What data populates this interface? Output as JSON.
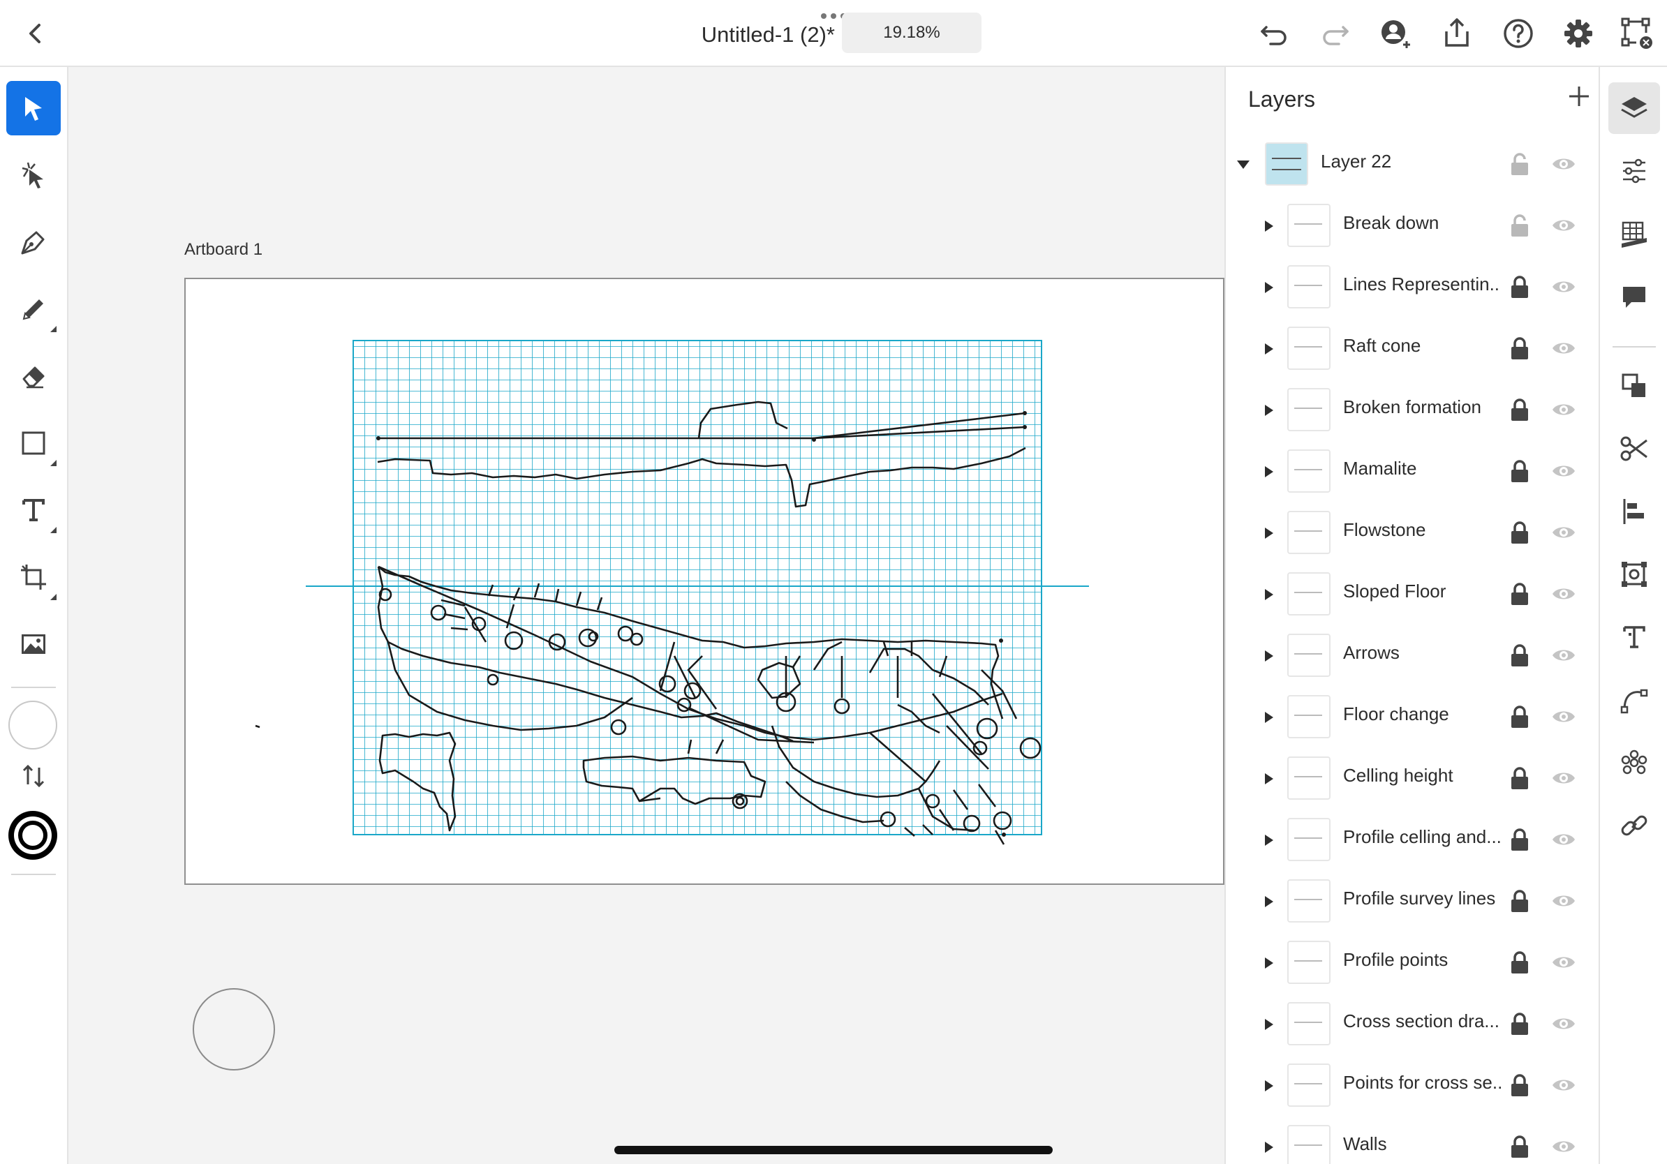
{
  "document": {
    "title": "Untitled-1 (2)*",
    "zoom": "19.18%"
  },
  "canvas": {
    "artboard_label": "Artboard 1"
  },
  "layers_panel": {
    "title": "Layers",
    "layers": [
      {
        "name": "Layer 22",
        "expanded": true,
        "locked": false,
        "visible": true,
        "level": 0
      },
      {
        "name": "Break down",
        "expanded": false,
        "locked": false,
        "visible": true,
        "level": 1
      },
      {
        "name": "Lines Representin...",
        "expanded": false,
        "locked": true,
        "visible": true,
        "level": 1
      },
      {
        "name": "Raft cone",
        "expanded": false,
        "locked": true,
        "visible": true,
        "level": 1
      },
      {
        "name": "Broken formation",
        "expanded": false,
        "locked": true,
        "visible": true,
        "level": 1
      },
      {
        "name": "Mamalite",
        "expanded": false,
        "locked": true,
        "visible": true,
        "level": 1
      },
      {
        "name": "Flowstone",
        "expanded": false,
        "locked": true,
        "visible": true,
        "level": 1
      },
      {
        "name": "Sloped Floor",
        "expanded": false,
        "locked": true,
        "visible": true,
        "level": 1
      },
      {
        "name": "Arrows",
        "expanded": false,
        "locked": true,
        "visible": true,
        "level": 1
      },
      {
        "name": "Floor change",
        "expanded": false,
        "locked": true,
        "visible": true,
        "level": 1
      },
      {
        "name": "Celling height",
        "expanded": false,
        "locked": true,
        "visible": true,
        "level": 1
      },
      {
        "name": "Profile celling and...",
        "expanded": false,
        "locked": true,
        "visible": true,
        "level": 1
      },
      {
        "name": "Profile survey lines",
        "expanded": false,
        "locked": true,
        "visible": true,
        "level": 1
      },
      {
        "name": "Profile points",
        "expanded": false,
        "locked": true,
        "visible": true,
        "level": 1
      },
      {
        "name": "Cross section dra...",
        "expanded": false,
        "locked": true,
        "visible": true,
        "level": 1
      },
      {
        "name": "Points for cross se...",
        "expanded": false,
        "locked": true,
        "visible": true,
        "level": 1
      },
      {
        "name": "Walls",
        "expanded": false,
        "locked": true,
        "visible": true,
        "level": 1
      }
    ]
  },
  "left_tools": [
    {
      "name": "selection-tool",
      "icon": "arrow-icon",
      "active": true
    },
    {
      "name": "direct-selection-tool",
      "icon": "direct-select-icon",
      "active": false
    },
    {
      "name": "pen-tool",
      "icon": "pen-icon",
      "active": false
    },
    {
      "name": "pencil-tool",
      "icon": "pencil-icon",
      "active": false
    },
    {
      "name": "eraser-tool",
      "icon": "eraser-icon",
      "active": false
    },
    {
      "name": "rectangle-tool",
      "icon": "rectangle-icon",
      "active": false
    },
    {
      "name": "type-tool",
      "icon": "type-icon",
      "active": false
    },
    {
      "name": "transform-tool",
      "icon": "crop-icon",
      "active": false
    },
    {
      "name": "place-image-tool",
      "icon": "image-icon",
      "active": false
    }
  ],
  "right_rail": [
    "layers-icon",
    "properties-icon",
    "grid-ruler-icon",
    "comment-icon",
    "combine-shapes-icon",
    "scissors-icon",
    "align-icon",
    "group-icon",
    "type-panel-icon",
    "path-icon",
    "repeat-icon",
    "link-icon"
  ],
  "colors": {
    "accent": "#1473e6",
    "grid": "#1aa7c8",
    "ink": "#1a1a1a"
  }
}
